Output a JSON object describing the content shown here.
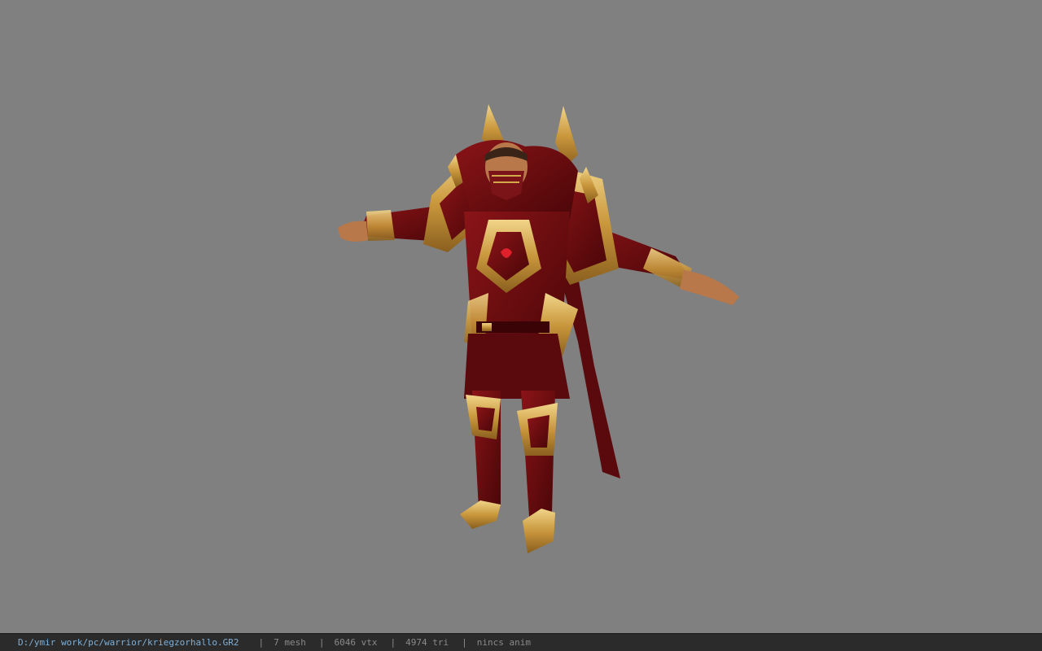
{
  "viewer": {
    "background_color": "#808080",
    "model": {
      "icon": "armored-warrior-model",
      "colors": {
        "armor_red": "#6e0c10",
        "armor_gold": "#d4a94a",
        "skin": "#b8784a"
      }
    }
  },
  "status_bar": {
    "file_path": "D:/ymir work/pc/warrior/kriegzorhallo.GR2",
    "separator": "|",
    "mesh_count": "7 mesh",
    "vertex_count": "6046 vtx",
    "triangle_count": "4974 tri",
    "animation": "nincs anim",
    "path_color": "#7fb0d8",
    "text_color": "#8a8a8a"
  }
}
